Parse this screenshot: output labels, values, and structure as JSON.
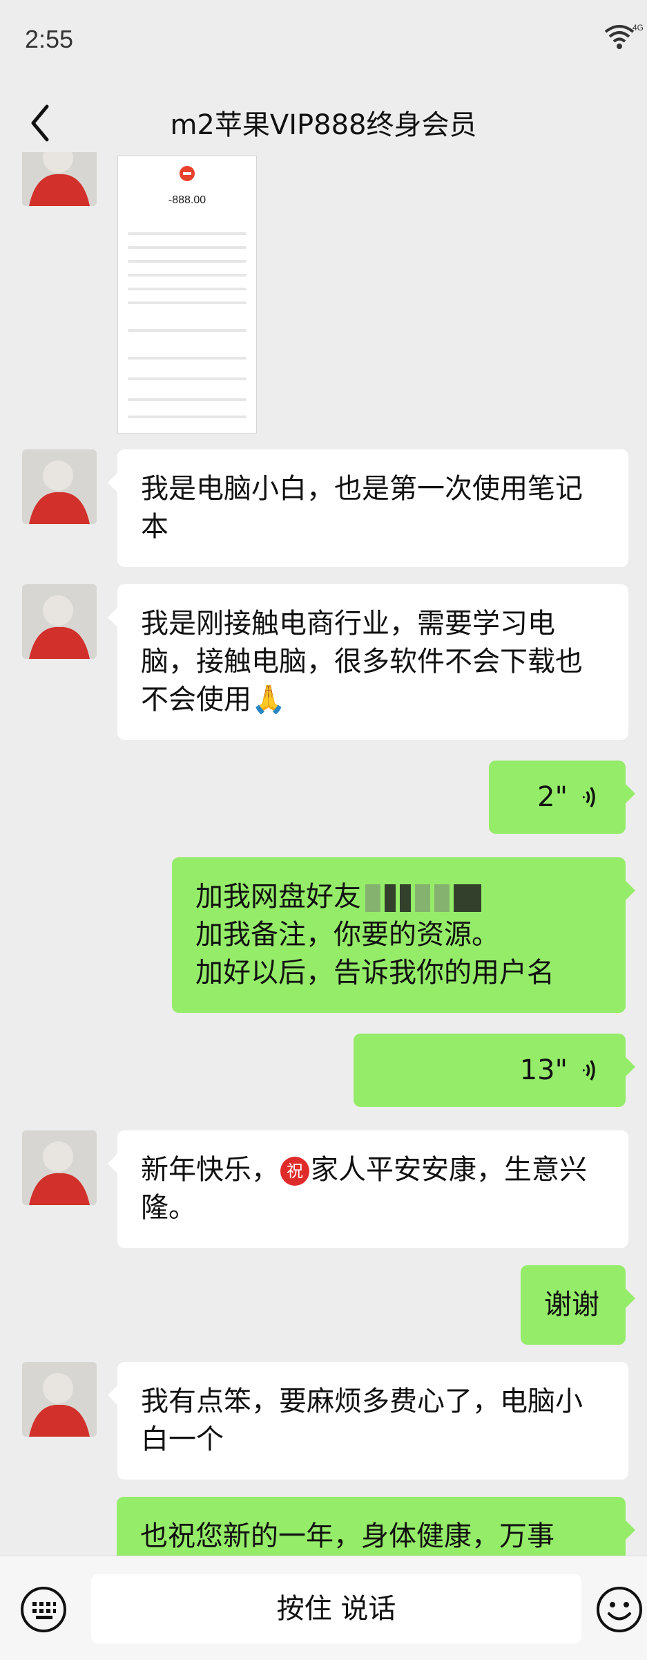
{
  "status": {
    "time": "2:55",
    "network": "4G"
  },
  "nav": {
    "title": "m2苹果VIP888终身会员"
  },
  "receipt": {
    "amount": "-888.00"
  },
  "messages": {
    "m1": "我是电脑小白，也是第一次使用笔记本",
    "m2": "我是刚接触电商行业，需要学习电脑，接触电脑，很多软件不会下载也不会使用",
    "m2_emoji": "🙏",
    "voice1": "2\"",
    "m3_line1": "加我网盘好友",
    "m3_line2": "加我备注，你要的资源。",
    "m3_line3": "加好以后，告诉我你的用户名",
    "voice2": "13\"",
    "m4_pre": "新年快乐，",
    "m4_badge": "祝",
    "m4_post": "家人平安安康，生意兴隆。",
    "m5": "谢谢",
    "m6": "我有点笨，要麻烦多费心了，电脑小白一个",
    "m7": "也祝您新的一年，身体健康，万事"
  },
  "input": {
    "hold_to_talk": "按住 说话"
  },
  "colors": {
    "background": "#ededed",
    "incoming": "#ffffff",
    "outgoing": "#95ec69",
    "badge": "#e02b2b"
  }
}
